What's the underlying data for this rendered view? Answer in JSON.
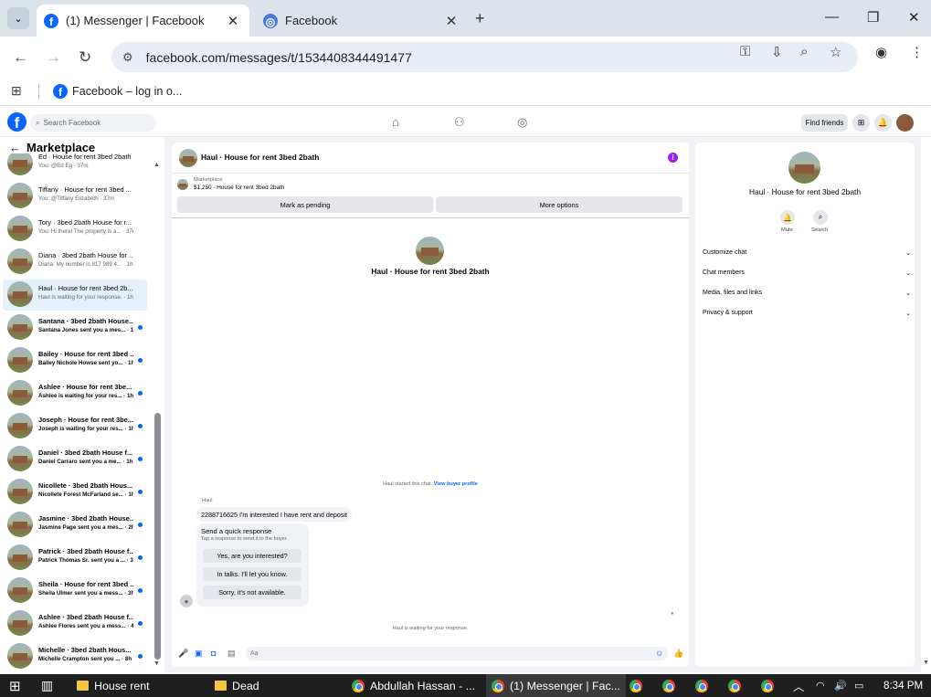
{
  "browser": {
    "tabs": [
      {
        "title": "(1) Messenger | Facebook",
        "active": true
      },
      {
        "title": "Facebook",
        "active": false
      }
    ],
    "url": "facebook.com/messages/t/1534408344491477",
    "bookmark": "Facebook – log in o..."
  },
  "fb_header": {
    "search_placeholder": "Search Facebook",
    "find_friends": "Find friends"
  },
  "sidebar": {
    "title": "Marketplace",
    "conversations": [
      {
        "name": "Ed · House for rent 3bed 2bath",
        "preview": "You: @Ed Eg · 37m",
        "unread": false,
        "active": false
      },
      {
        "name": "Tiffany · House for rent 3bed ...",
        "preview": "You: @Tiffany Elizabeth · 37m",
        "unread": false,
        "active": false
      },
      {
        "name": "Tory · 3bed 2bath House for r...",
        "preview": "You: Hi there! The property is a... · 37m",
        "unread": false,
        "active": false
      },
      {
        "name": "Diana · 3bed 2bath House for ...",
        "preview": "Diana: My number is 817 989 4... · 1h",
        "unread": false,
        "active": false
      },
      {
        "name": "Haul · House for rent 3bed 2b...",
        "preview": "Haul is waiting for your response. · 1h",
        "unread": false,
        "active": true
      },
      {
        "name": "Santana · 3bed 2bath House...",
        "preview": "Santana Jones sent you a mes... · 1h",
        "unread": true,
        "active": false
      },
      {
        "name": "Bailey · House for rent 3bed ...",
        "preview": "Bailey Nichole Howse sent yo... · 1h",
        "unread": true,
        "active": false
      },
      {
        "name": "Ashlee · House for rent 3be...",
        "preview": "Ashlee is waiting for your res... · 1h",
        "unread": true,
        "active": false
      },
      {
        "name": "Joseph · House for rent 3be...",
        "preview": "Joseph is waiting for your res... · 1h",
        "unread": true,
        "active": false
      },
      {
        "name": "Daniel · 3bed 2bath House f...",
        "preview": "Daniel Carraro sent you a me... · 1h",
        "unread": true,
        "active": false
      },
      {
        "name": "Nicollete · 3bed 2bath Hous...",
        "preview": "Nicollete Forest McFarland se... · 1h",
        "unread": true,
        "active": false
      },
      {
        "name": "Jasmine · 3bed 2bath House...",
        "preview": "Jasmine Page sent you a mes... · 2h",
        "unread": true,
        "active": false
      },
      {
        "name": "Patrick · 3bed 2bath House f...",
        "preview": "Patrick Thomas Sr. sent you a ... · 3h",
        "unread": true,
        "active": false
      },
      {
        "name": "Sheila · House for rent 3bed ...",
        "preview": "Sheila Ulmer sent you a mess... · 3h",
        "unread": true,
        "active": false
      },
      {
        "name": "Ashlee · 3bed 2bath House f...",
        "preview": "Ashlee Flores sent you a mess... · 4h",
        "unread": true,
        "active": false
      },
      {
        "name": "Michelle · 3bed 2bath Hous...",
        "preview": "Michelle Crampton sent you ... · 8h",
        "unread": true,
        "active": false
      }
    ]
  },
  "chat": {
    "title": "Haul · House for rent 3bed 2bath",
    "marketplace_label": "Marketplace",
    "listing": "$1,250 · House for rent 3bed 2bath",
    "mark_pending": "Mark as pending",
    "more_options": "More options",
    "center_title": "Haul · House for rent 3bed 2bath",
    "started_text": "Haul started this chat.",
    "view_profile": "View buyer profile",
    "sender": "Haul",
    "message": "2288716625 I'm interested I have rent and deposit",
    "quick_title": "Send a quick response",
    "quick_sub": "Tap a response to send it to the buyer.",
    "quick_replies": [
      "Yes, are you interested?",
      "In talks. I'll let you know.",
      "Sorry, it's not available."
    ],
    "waiting": "Haul is waiting for your response.",
    "input_placeholder": "Aa"
  },
  "right_panel": {
    "name": "Haul · House for rent 3bed 2bath",
    "mute": "Mute",
    "search": "Search",
    "sections": [
      "Customize chat",
      "Chat members",
      "Media, files and links",
      "Privacy & support"
    ]
  },
  "taskbar": {
    "items": [
      "House rent",
      "Dead",
      "Abdullah Hassan - ...",
      "(1) Messenger | Fac..."
    ],
    "time": "8:34 PM"
  }
}
